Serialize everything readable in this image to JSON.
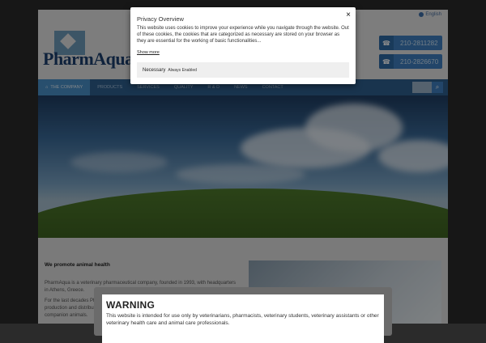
{
  "header": {
    "language": "English",
    "logo_text": "PharmAqua",
    "phones": [
      "210-2811282",
      "210-2826670"
    ]
  },
  "nav": {
    "items": [
      "THE COMPANY",
      "PRODUCTS",
      "SERVICES",
      "QUALITY",
      "R & D",
      "NEWS",
      "CONTACT"
    ]
  },
  "content": {
    "tagline": "We promote animal health",
    "paragraphs": [
      "PharmAqua is a veterinary pharmaceutical company, founded in 1993, with headquarters in Athens, Greece.",
      "For the last decades PharmAqua has been active in the research, development, production and distribution of high quality veterinary products for food producing and companion animals."
    ]
  },
  "privacy": {
    "title": "Privacy Overview",
    "close": "×",
    "text": "This website uses cookies to improve your experience while you navigate through the website. Out of these cookies, the cookies that are categorized as necessary are stored on your browser as they are essential for the working of basic functionalities...",
    "show_more": "Show more",
    "necessary_label": "Necessary",
    "necessary_status": "Always Enabled"
  },
  "warning": {
    "title": "WARNING",
    "text": "This website is intended for use only by veterinarians, pharmacists, veterinary students, veterinary assistants or other veterinary health care and animal care professionals."
  },
  "colors": {
    "nav_bg": "#2f5f8f",
    "nav_active": "#4a90c8",
    "phone_bg": "#3e7fbf",
    "logo": "#1c3f6e"
  }
}
